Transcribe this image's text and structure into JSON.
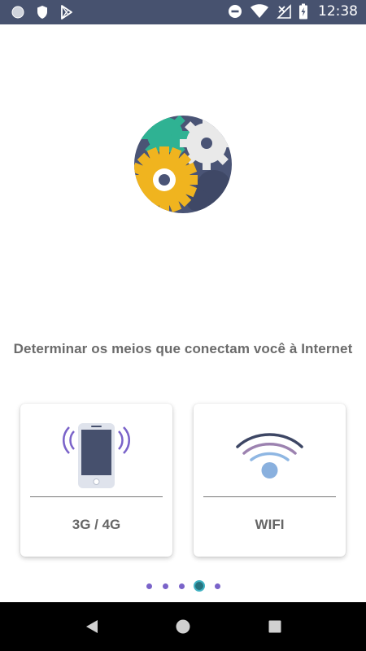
{
  "status_bar": {
    "time": "12:38",
    "left_icons": [
      "circle-icon",
      "shield-icon",
      "play-store-icon"
    ],
    "right_icons": [
      "do-not-disturb-icon",
      "wifi-icon",
      "no-signal-icon",
      "battery-icon"
    ]
  },
  "hero": {
    "icon": "gears-logo-icon",
    "headline": "Determinar os meios que conectam você à Internet"
  },
  "cards": [
    {
      "label": "3G / 4G",
      "icon": "mobile-phone-icon"
    },
    {
      "label": "WIFI",
      "icon": "wifi-signal-icon"
    }
  ],
  "pager": {
    "total": 5,
    "active_index": 3
  },
  "colors": {
    "status_bar": "#47526f",
    "gear_teal": "#2fb293",
    "gear_yellow": "#f0b41f",
    "gear_white": "#e8e8e8",
    "dot": "#7a63c9",
    "dot_active": "#26737f"
  },
  "nav": [
    "back-button",
    "home-button",
    "recents-button"
  ]
}
